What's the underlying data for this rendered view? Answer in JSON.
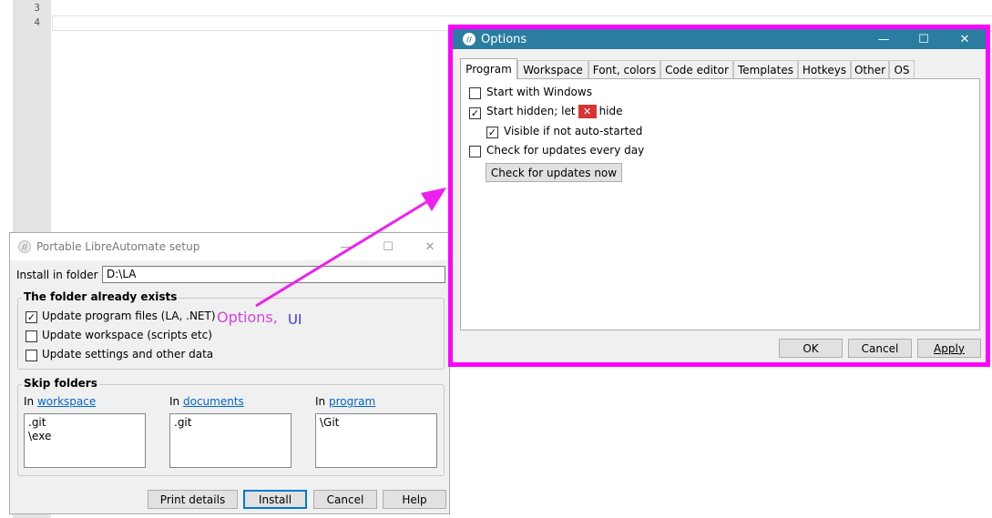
{
  "editor": {
    "line_numbers": [
      "3",
      "4"
    ]
  },
  "setup": {
    "title": "Portable LibreAutomate setup",
    "install_label": "Install in folder",
    "install_path": "D:\\LA",
    "exists_group": {
      "title": "The folder already exists",
      "items": [
        {
          "label": "Update program files (LA, .NET)",
          "checked": true
        },
        {
          "label": "Update workspace (scripts etc)",
          "checked": false
        },
        {
          "label": "Update settings and other data",
          "checked": false
        }
      ]
    },
    "skip_group": {
      "title": "Skip folders",
      "columns": [
        {
          "prefix": "In",
          "link": "workspace",
          "entries": [
            ".git",
            "\\exe"
          ]
        },
        {
          "prefix": "In",
          "link": "documents",
          "entries": [
            ".git"
          ]
        },
        {
          "prefix": "In",
          "link": "program",
          "entries": [
            "\\Git"
          ]
        }
      ]
    },
    "buttons": {
      "print": "Print details",
      "install": "Install",
      "cancel": "Cancel",
      "help": "Help"
    }
  },
  "options": {
    "title": "Options",
    "tabs": [
      "Program",
      "Workspace",
      "Font, colors",
      "Code editor",
      "Templates",
      "Hotkeys",
      "Other",
      "OS"
    ],
    "active_tab": "Program",
    "start_windows": "Start with Windows",
    "start_hidden_pre": "Start hidden; let",
    "start_hidden_post": "hide",
    "visible_if": "Visible if not auto-started",
    "check_updates_daily": "Check for updates every day",
    "check_now": "Check for updates now",
    "buttons": {
      "ok": "OK",
      "cancel": "Cancel",
      "apply": "Apply"
    }
  },
  "annotation": {
    "text1": "Options,",
    "text2": "UI"
  },
  "colors": {
    "titlebar": "#2a7da0",
    "highlight": "#ff00ff",
    "arrow": "#ee20ee"
  },
  "icons": [
    "libreautomate-logo-icon",
    "minimize-icon",
    "maximize-icon",
    "close-icon",
    "checkmark-icon",
    "x-close-badge-icon"
  ]
}
